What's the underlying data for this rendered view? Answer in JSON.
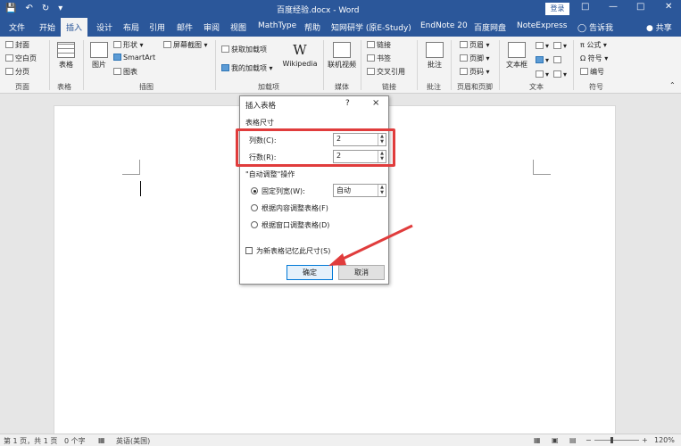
{
  "titlebar": {
    "save_icon": "save-icon",
    "undo_icon": "undo-icon",
    "redo_icon": "redo-icon",
    "doc_title": "百度经验.docx - Word",
    "login_label": "登录",
    "minimize_icon": "minimize-icon",
    "restore_icon": "restore-icon",
    "close_icon": "close-icon"
  },
  "tabs": [
    {
      "label": "文件"
    },
    {
      "label": "开始"
    },
    {
      "label": "插入"
    },
    {
      "label": "设计"
    },
    {
      "label": "布局"
    },
    {
      "label": "引用"
    },
    {
      "label": "邮件"
    },
    {
      "label": "审阅"
    },
    {
      "label": "视图"
    },
    {
      "label": "MathType"
    },
    {
      "label": "帮助"
    },
    {
      "label": "知网研学 (原E-Study)"
    },
    {
      "label": "EndNote 20"
    },
    {
      "label": "百度网盘"
    },
    {
      "label": "NoteExpress"
    }
  ],
  "tellme": "告诉我",
  "share": "共享",
  "ribbon": {
    "pages": {
      "cover": "封面",
      "blank": "空白页",
      "break": "分页",
      "label": "页面"
    },
    "table": {
      "btn": "表格",
      "label": "表格"
    },
    "illustrations": {
      "picture": "图片",
      "shapes": "形状",
      "smartart": "SmartArt",
      "chart": "图表",
      "screenshot": "屏幕截图",
      "label": "插图"
    },
    "addins": {
      "get": "获取加载项",
      "mine": "我的加载项",
      "wikipedia": "Wikipedia",
      "label": "加载项"
    },
    "media": {
      "video": "联机视频",
      "label": "媒体"
    },
    "links": {
      "link": "链接",
      "bookmark": "书签",
      "xref": "交叉引用",
      "label": "链接"
    },
    "comments": {
      "comment": "批注",
      "label": "批注"
    },
    "headerfooter": {
      "header": "页眉",
      "footer": "页脚",
      "pagenum": "页码",
      "label": "页眉和页脚"
    },
    "text": {
      "textbox": "文本框",
      "label": "文本"
    },
    "symbols": {
      "equation": "公式",
      "symbol": "符号",
      "number": "编号",
      "label": "符号"
    }
  },
  "dialog": {
    "title": "插入表格",
    "help": "?",
    "close": "×",
    "size_section": "表格尺寸",
    "columns_label": "列数(C):",
    "columns_value": "2",
    "rows_label": "行数(R):",
    "rows_value": "2",
    "autofit_section": "\"自动调整\"操作",
    "fixed_label": "固定列宽(W):",
    "fixed_value": "自动",
    "content_label": "根据内容调整表格(F)",
    "window_label": "根据窗口调整表格(D)",
    "remember_label": "为新表格记忆此尺寸(S)",
    "ok": "确定",
    "cancel": "取消"
  },
  "annotations": {
    "highlight_color": "#e03c3c",
    "arrow_color": "#e03c3c"
  },
  "statusbar": {
    "page": "第 1 页，共 1 页",
    "words": "0 个字",
    "language": "英语(美国)",
    "zoom": "120%"
  },
  "colors": {
    "accent": "#2b579a",
    "ribbon_bg": "#f3f3f3"
  }
}
